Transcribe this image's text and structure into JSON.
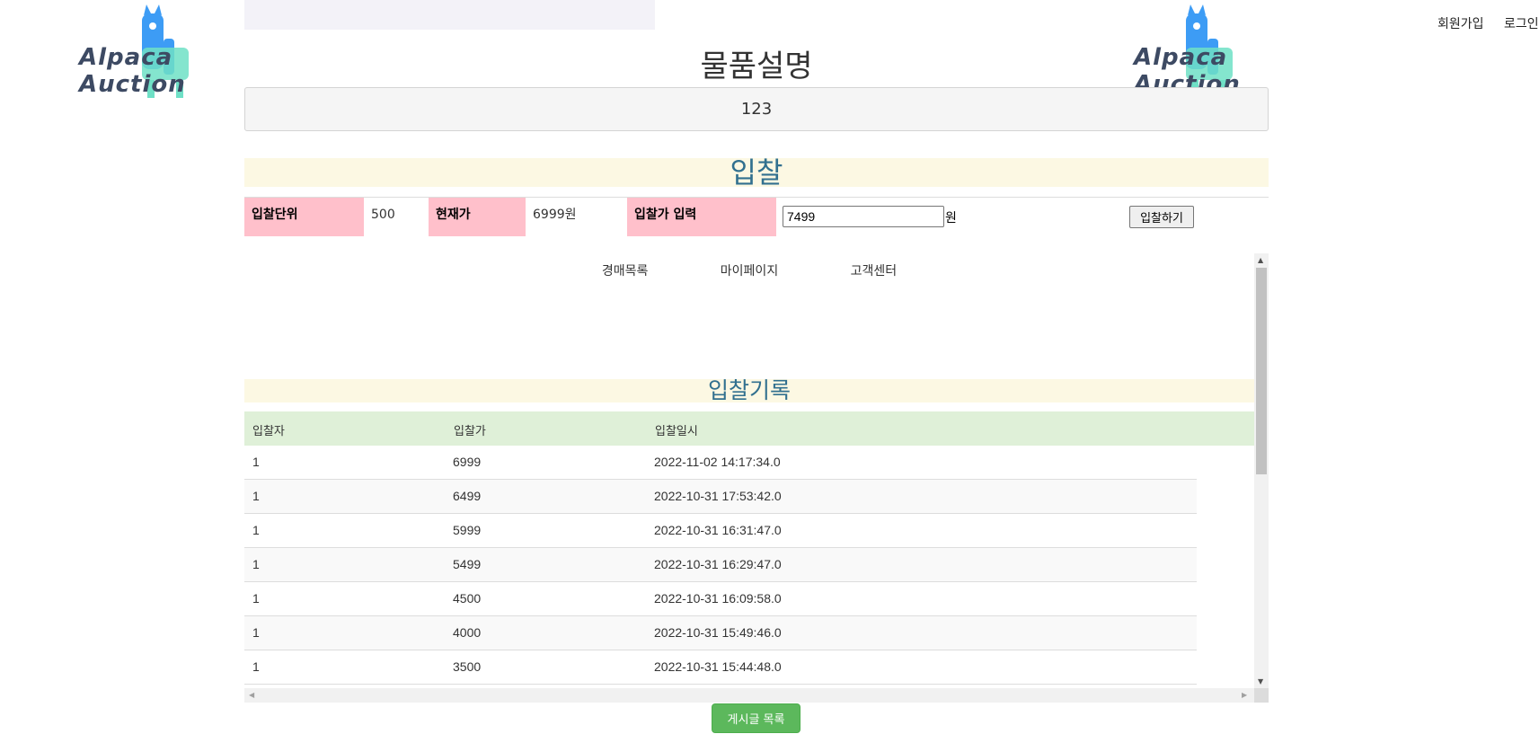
{
  "brand": {
    "line1": "Alpaca",
    "line2": "Auction"
  },
  "header": {
    "signup": "회원가입",
    "login": "로그인"
  },
  "description": {
    "title": "물품설명",
    "content": "123"
  },
  "bid": {
    "title": "입찰",
    "unit_label": "입찰단위",
    "unit_value": "500",
    "current_label": "현재가",
    "current_value": "6999원",
    "input_label": "입찰가 입력",
    "input_value": "7499",
    "currency": "원",
    "submit_label": "입찰하기"
  },
  "nav": {
    "auction_list": "경매목록",
    "my_page": "마이페이지",
    "support": "고객센터"
  },
  "history": {
    "title": "입찰기록",
    "columns": [
      "입찰자",
      "입찰가",
      "입찰일시"
    ],
    "rows": [
      [
        "1",
        "6999",
        "2022-11-02 14:17:34.0"
      ],
      [
        "1",
        "6499",
        "2022-10-31 17:53:42.0"
      ],
      [
        "1",
        "5999",
        "2022-10-31 16:31:47.0"
      ],
      [
        "1",
        "5499",
        "2022-10-31 16:29:47.0"
      ],
      [
        "1",
        "4500",
        "2022-10-31 16:09:58.0"
      ],
      [
        "1",
        "4000",
        "2022-10-31 15:49:46.0"
      ],
      [
        "1",
        "3500",
        "2022-10-31 15:44:48.0"
      ]
    ]
  },
  "footer": {
    "list_button": "게시글 목록"
  },
  "colors": {
    "bid_label_bg": "#ffc0cb",
    "title_bg": "#fcf8e3",
    "title_text": "#31708f",
    "table_head_bg": "#dff0d8",
    "list_button_bg": "#5cb85c"
  },
  "icons": {
    "logo": "alpaca-logo-icon"
  }
}
